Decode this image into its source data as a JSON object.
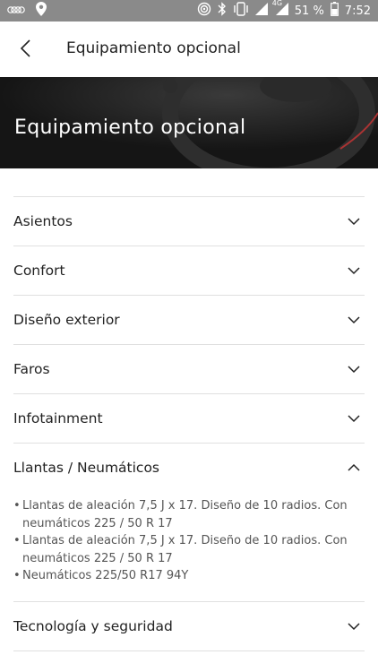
{
  "statusbar": {
    "battery": "51 %",
    "time": "7:52",
    "network": "4G",
    "icons": [
      "audi-logo-icon",
      "location-icon",
      "hotspot-icon",
      "bluetooth-icon",
      "vibrate-icon",
      "signal-icon",
      "signal-4g-icon",
      "battery-icon"
    ]
  },
  "header": {
    "title": "Equipamiento opcional",
    "back_icon": "back-arrow-icon"
  },
  "hero": {
    "title": "Equipamiento opcional"
  },
  "sections": [
    {
      "label": "Asientos",
      "expanded": false
    },
    {
      "label": "Confort",
      "expanded": false
    },
    {
      "label": "Diseño exterior",
      "expanded": false
    },
    {
      "label": "Faros",
      "expanded": false
    },
    {
      "label": "Infotainment",
      "expanded": false
    },
    {
      "label": "Llantas / Neumáticos",
      "expanded": true,
      "items": [
        {
          "line1": "Llantas de aleación 7,5 J x 17. Diseño de 10 radios. Con",
          "line2": "neumáticos 225 / 50 R 17"
        },
        {
          "line1": "Llantas de aleación 7,5 J x 17. Diseño de 10 radios. Con",
          "line2": "neumáticos 225 / 50 R 17"
        },
        {
          "line1": "Neumáticos 225/50 R17 94Y",
          "line2": ""
        }
      ]
    },
    {
      "label": "Tecnología y seguridad",
      "expanded": false
    }
  ],
  "bullet_char": "•",
  "colors": {
    "statusbar": "#8a8a8a",
    "divider": "#e0e0e0",
    "hero": "#1a1a1a"
  }
}
